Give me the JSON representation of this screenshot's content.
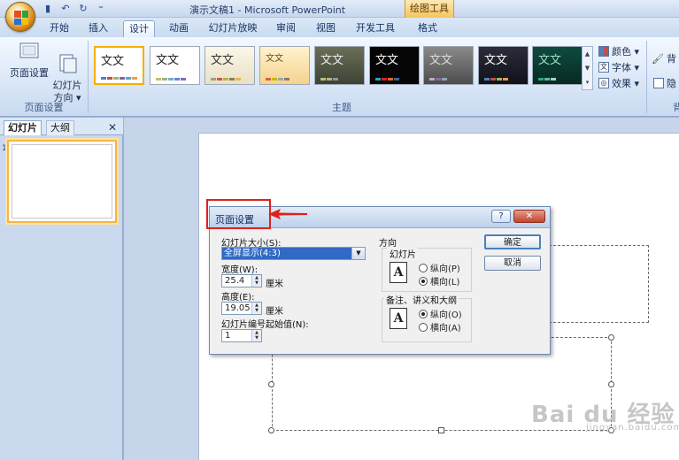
{
  "window": {
    "title": "演示文稿1 - Microsoft PowerPoint",
    "context_tab": "绘图工具"
  },
  "qat": {
    "save": "▮",
    "undo": "↶",
    "redo": "↻",
    "more": "⁼"
  },
  "tabs": [
    "开始",
    "插入",
    "设计",
    "动画",
    "幻灯片放映",
    "审阅",
    "视图",
    "开发工具",
    "格式"
  ],
  "ribbon": {
    "page_setup_group": {
      "label": "页面设置",
      "page_setup": "页面设置",
      "orientation": "幻灯片\n方向 ▾"
    },
    "themes_group": {
      "label": "主题",
      "theme_text": "文文"
    },
    "options": {
      "colors": "颜色 ▾",
      "fonts": "字体 ▾",
      "effects": "效果 ▾"
    },
    "background": {
      "label1": "背",
      "label2": "隐",
      "group": "背"
    }
  },
  "left_pane": {
    "tab_slides": "幻灯片",
    "tab_outline": "大纲",
    "close": "✕",
    "slide_number": "1"
  },
  "dialog": {
    "title": "页面设置",
    "help": "?",
    "close": "✕",
    "slide_size_label": "幻灯片大小(S):",
    "slide_size_value": "全屏显示(4:3)",
    "width_label": "宽度(W):",
    "width_value": "25.4",
    "height_label": "高度(E):",
    "height_value": "19.05",
    "unit": "厘米",
    "start_number_label": "幻灯片编号起始值(N):",
    "start_number_value": "1",
    "orientation_heading": "方向",
    "slides_group": "幻灯片",
    "portrait": "纵向(P)",
    "landscape": "横向(L)",
    "notes_group": "备注、讲义和大纲",
    "notes_portrait": "纵向(O)",
    "notes_landscape": "横向(A)",
    "ok": "确定",
    "cancel": "取消"
  },
  "watermark": {
    "brand": "Bai du 经验",
    "url": "jingyan.baidu.com"
  },
  "colors": {
    "accent_red": "#e0201b",
    "selection_blue": "#316ac5"
  }
}
